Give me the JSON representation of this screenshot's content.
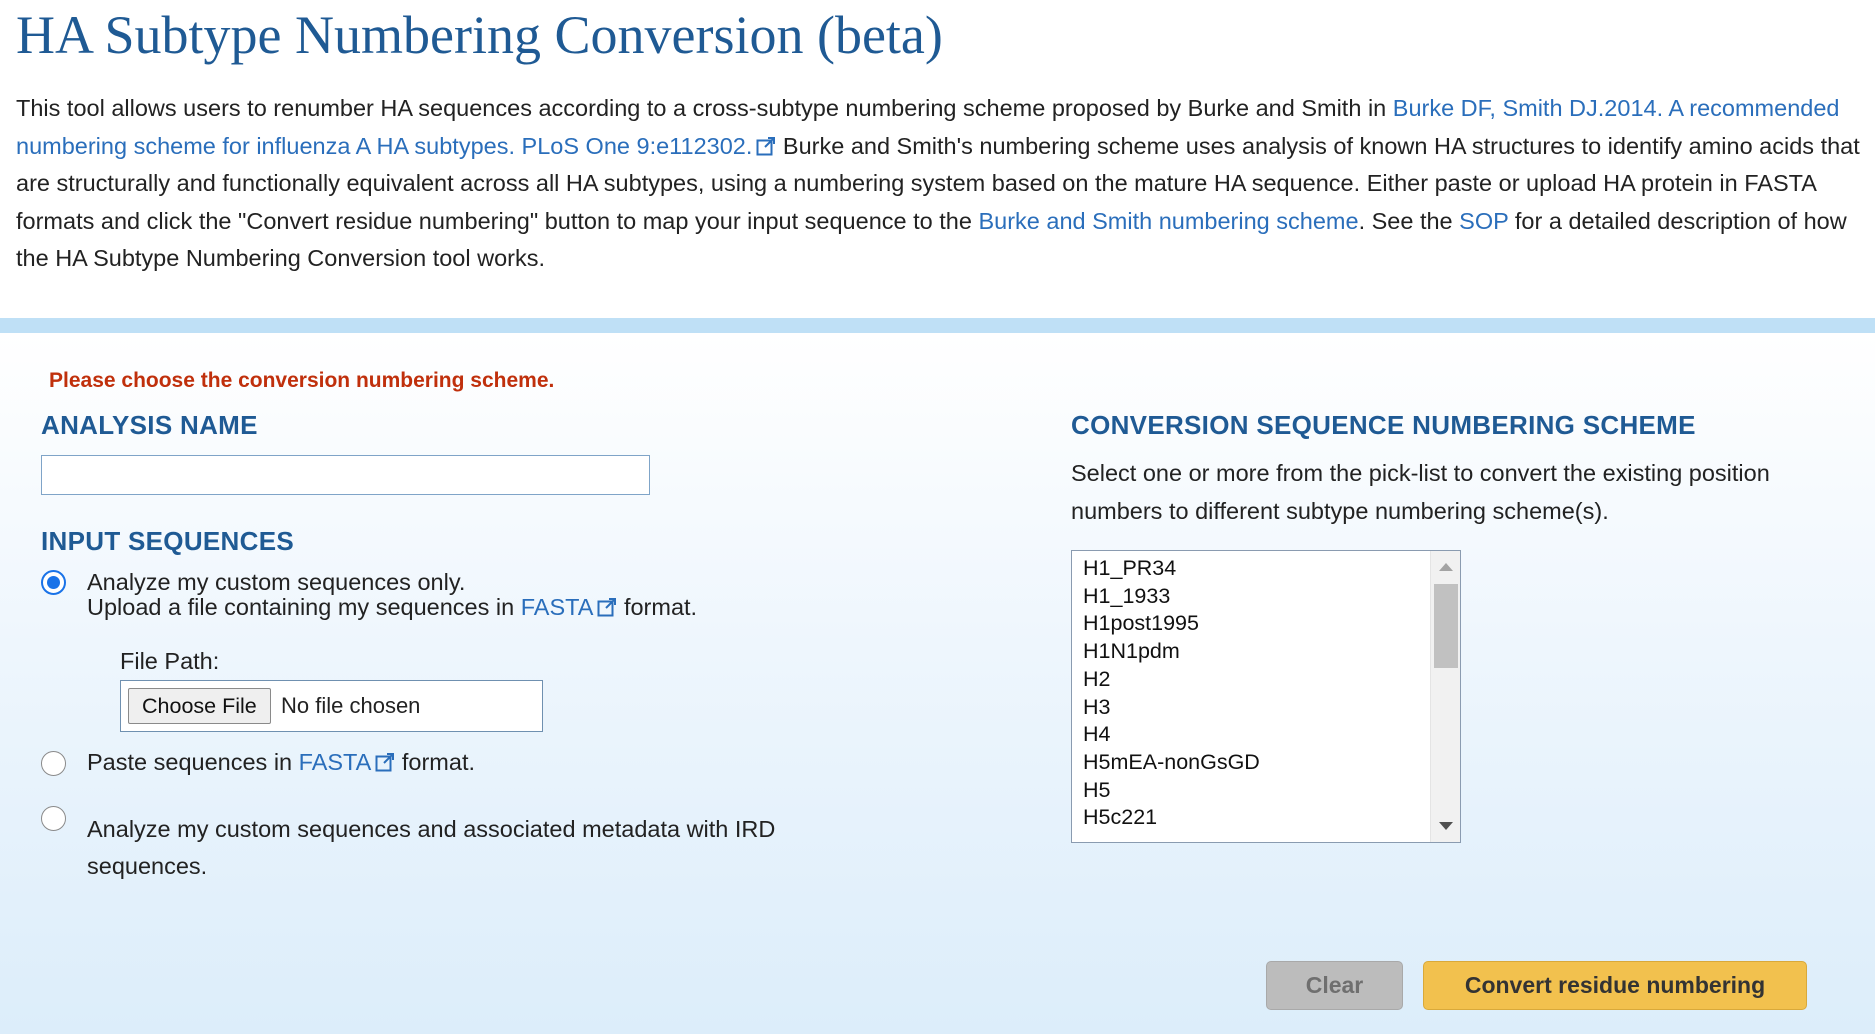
{
  "page": {
    "title": "HA Subtype Numbering Conversion (beta)"
  },
  "intro": {
    "text1": "This tool allows users to renumber HA sequences according to a cross-subtype numbering scheme proposed by Burke and Smith in ",
    "link_citation": "Burke DF, Smith DJ.2014. A recommended numbering scheme for influenza A HA subtypes. PLoS One 9:e112302.",
    "text2": " Burke and Smith's numbering scheme uses analysis of known HA structures to identify amino acids that are structurally and functionally equivalent across all HA subtypes, using a numbering system based on the mature HA sequence. Either paste or upload HA protein in FASTA formats and click the \"Convert residue numbering\" button to map your input sequence to the ",
    "link_scheme": "Burke and Smith numbering scheme",
    "text3": ". See the ",
    "link_sop": "SOP",
    "text4": " for a detailed description of how the HA Subtype Numbering Conversion tool works."
  },
  "form": {
    "error_message": "Please choose the conversion numbering scheme.",
    "analysis_name": {
      "heading": "ANALYSIS NAME",
      "value": "",
      "placeholder": ""
    },
    "input_sequences": {
      "heading": "INPUT SEQUENCES",
      "option_upload": {
        "line1": "Analyze my custom sequences only.",
        "line2_prefix": "Upload a file containing my sequences in ",
        "line2_link": "FASTA",
        "line2_suffix": " format.",
        "selected": true
      },
      "file_path_label": "File Path:",
      "choose_file_label": "Choose File",
      "no_file_text": "No file chosen",
      "option_paste": {
        "prefix": "Paste sequences in ",
        "link": "FASTA",
        "suffix": " format.",
        "selected": false
      },
      "option_metadata": {
        "line1": "Analyze my custom sequences and associated metadata with IRD",
        "line2": "sequences.",
        "selected": false
      }
    },
    "scheme": {
      "heading": "CONVERSION SEQUENCE NUMBERING SCHEME",
      "description": "Select one or more from the pick-list to convert the existing position numbers to different subtype numbering scheme(s).",
      "options": [
        "H1_PR34",
        "H1_1933",
        "H1post1995",
        "H1N1pdm",
        "H2",
        "H3",
        "H4",
        "H5mEA-nonGsGD",
        "H5",
        "H5c221"
      ]
    },
    "buttons": {
      "clear": "Clear",
      "convert": "Convert residue numbering"
    }
  },
  "colors": {
    "title": "#1f5a94",
    "link": "#2a6ebb",
    "error": "#c0300c",
    "heading": "#1f5a94",
    "band": "#bfe0f6",
    "convert_button": "#f2c14e",
    "clear_button": "#bcbcbc",
    "radio_selected": "#1a73e8"
  },
  "icons": {
    "external_link": "external-link-icon",
    "scroll_up": "chevron-up-icon",
    "scroll_down": "chevron-down-icon"
  }
}
